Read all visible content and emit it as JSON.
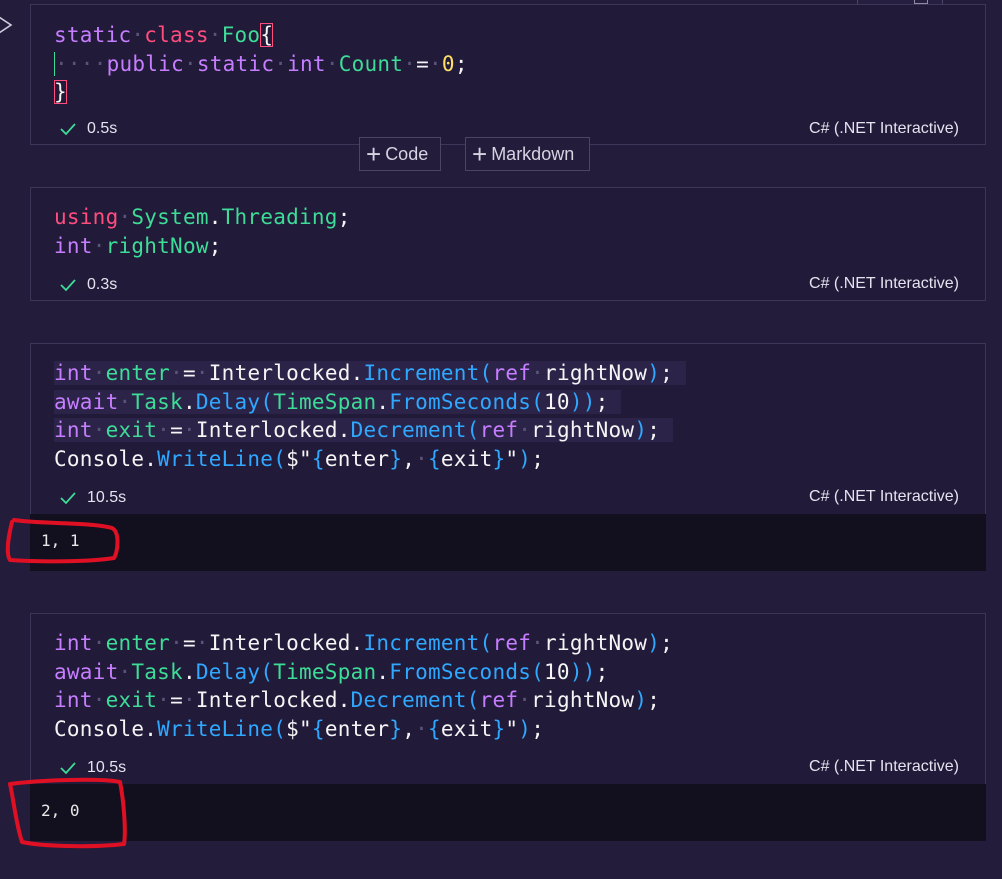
{
  "cells": [
    {
      "status_time": "0.5s",
      "language": "C# (.NET Interactive)"
    },
    {
      "status_time": "0.3s",
      "language": "C# (.NET Interactive)"
    },
    {
      "status_time": "10.5s",
      "language": "C# (.NET Interactive)",
      "output": "1, 1"
    },
    {
      "status_time": "10.5s",
      "language": "C# (.NET Interactive)",
      "output": "2, 0"
    }
  ],
  "toolbar": {
    "add_code_label": "Code",
    "add_markdown_label": "Markdown"
  },
  "icons": {
    "run": "play-triangle-icon",
    "check": "check-icon",
    "plus": "plus-icon",
    "delete": "trash-icon"
  },
  "colors": {
    "background": "#231c3b",
    "cell_background": "#211a39",
    "output_background": "#12101f",
    "keyword_red": "#ff4d7e",
    "keyword_purple": "#c77dff",
    "type_green": "#3ddc97",
    "method_blue": "#2fa8ff",
    "number_yellow": "#ffe066",
    "annotation_red": "#e01024"
  }
}
